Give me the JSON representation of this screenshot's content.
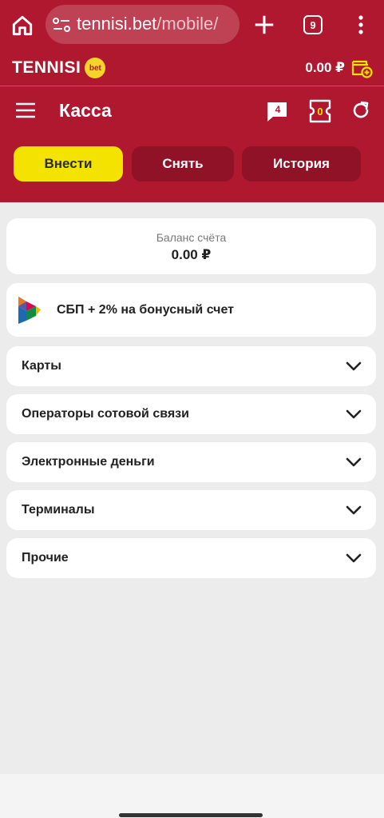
{
  "browser": {
    "url_domain": "tennisi.bet",
    "url_path": "/mobile/",
    "tab_count": "9",
    "icons": [
      "home-icon",
      "site-settings-icon",
      "plus-icon",
      "tabs-icon",
      "more-vert-icon"
    ]
  },
  "header": {
    "logo_text": "TENNISI",
    "logo_badge": "bet",
    "balance": "0.00 ₽",
    "title": "Касса",
    "messages_count": "4",
    "tickets_count": "0",
    "colors": {
      "brand": "#b0182f",
      "accent": "#f4e200",
      "tab_inactive": "#8f1227"
    }
  },
  "tabs": [
    {
      "label": "Внести",
      "active": true
    },
    {
      "label": "Снять",
      "active": false
    },
    {
      "label": "История",
      "active": false
    }
  ],
  "balance_card": {
    "label": "Баланс счёта",
    "value": "0.00 ₽"
  },
  "sbp": {
    "label": "СБП + 2% на бонусный счет"
  },
  "methods": [
    {
      "label": "Карты"
    },
    {
      "label": "Операторы сотовой связи"
    },
    {
      "label": "Электронные деньги"
    },
    {
      "label": "Терминалы"
    },
    {
      "label": "Прочие"
    }
  ]
}
